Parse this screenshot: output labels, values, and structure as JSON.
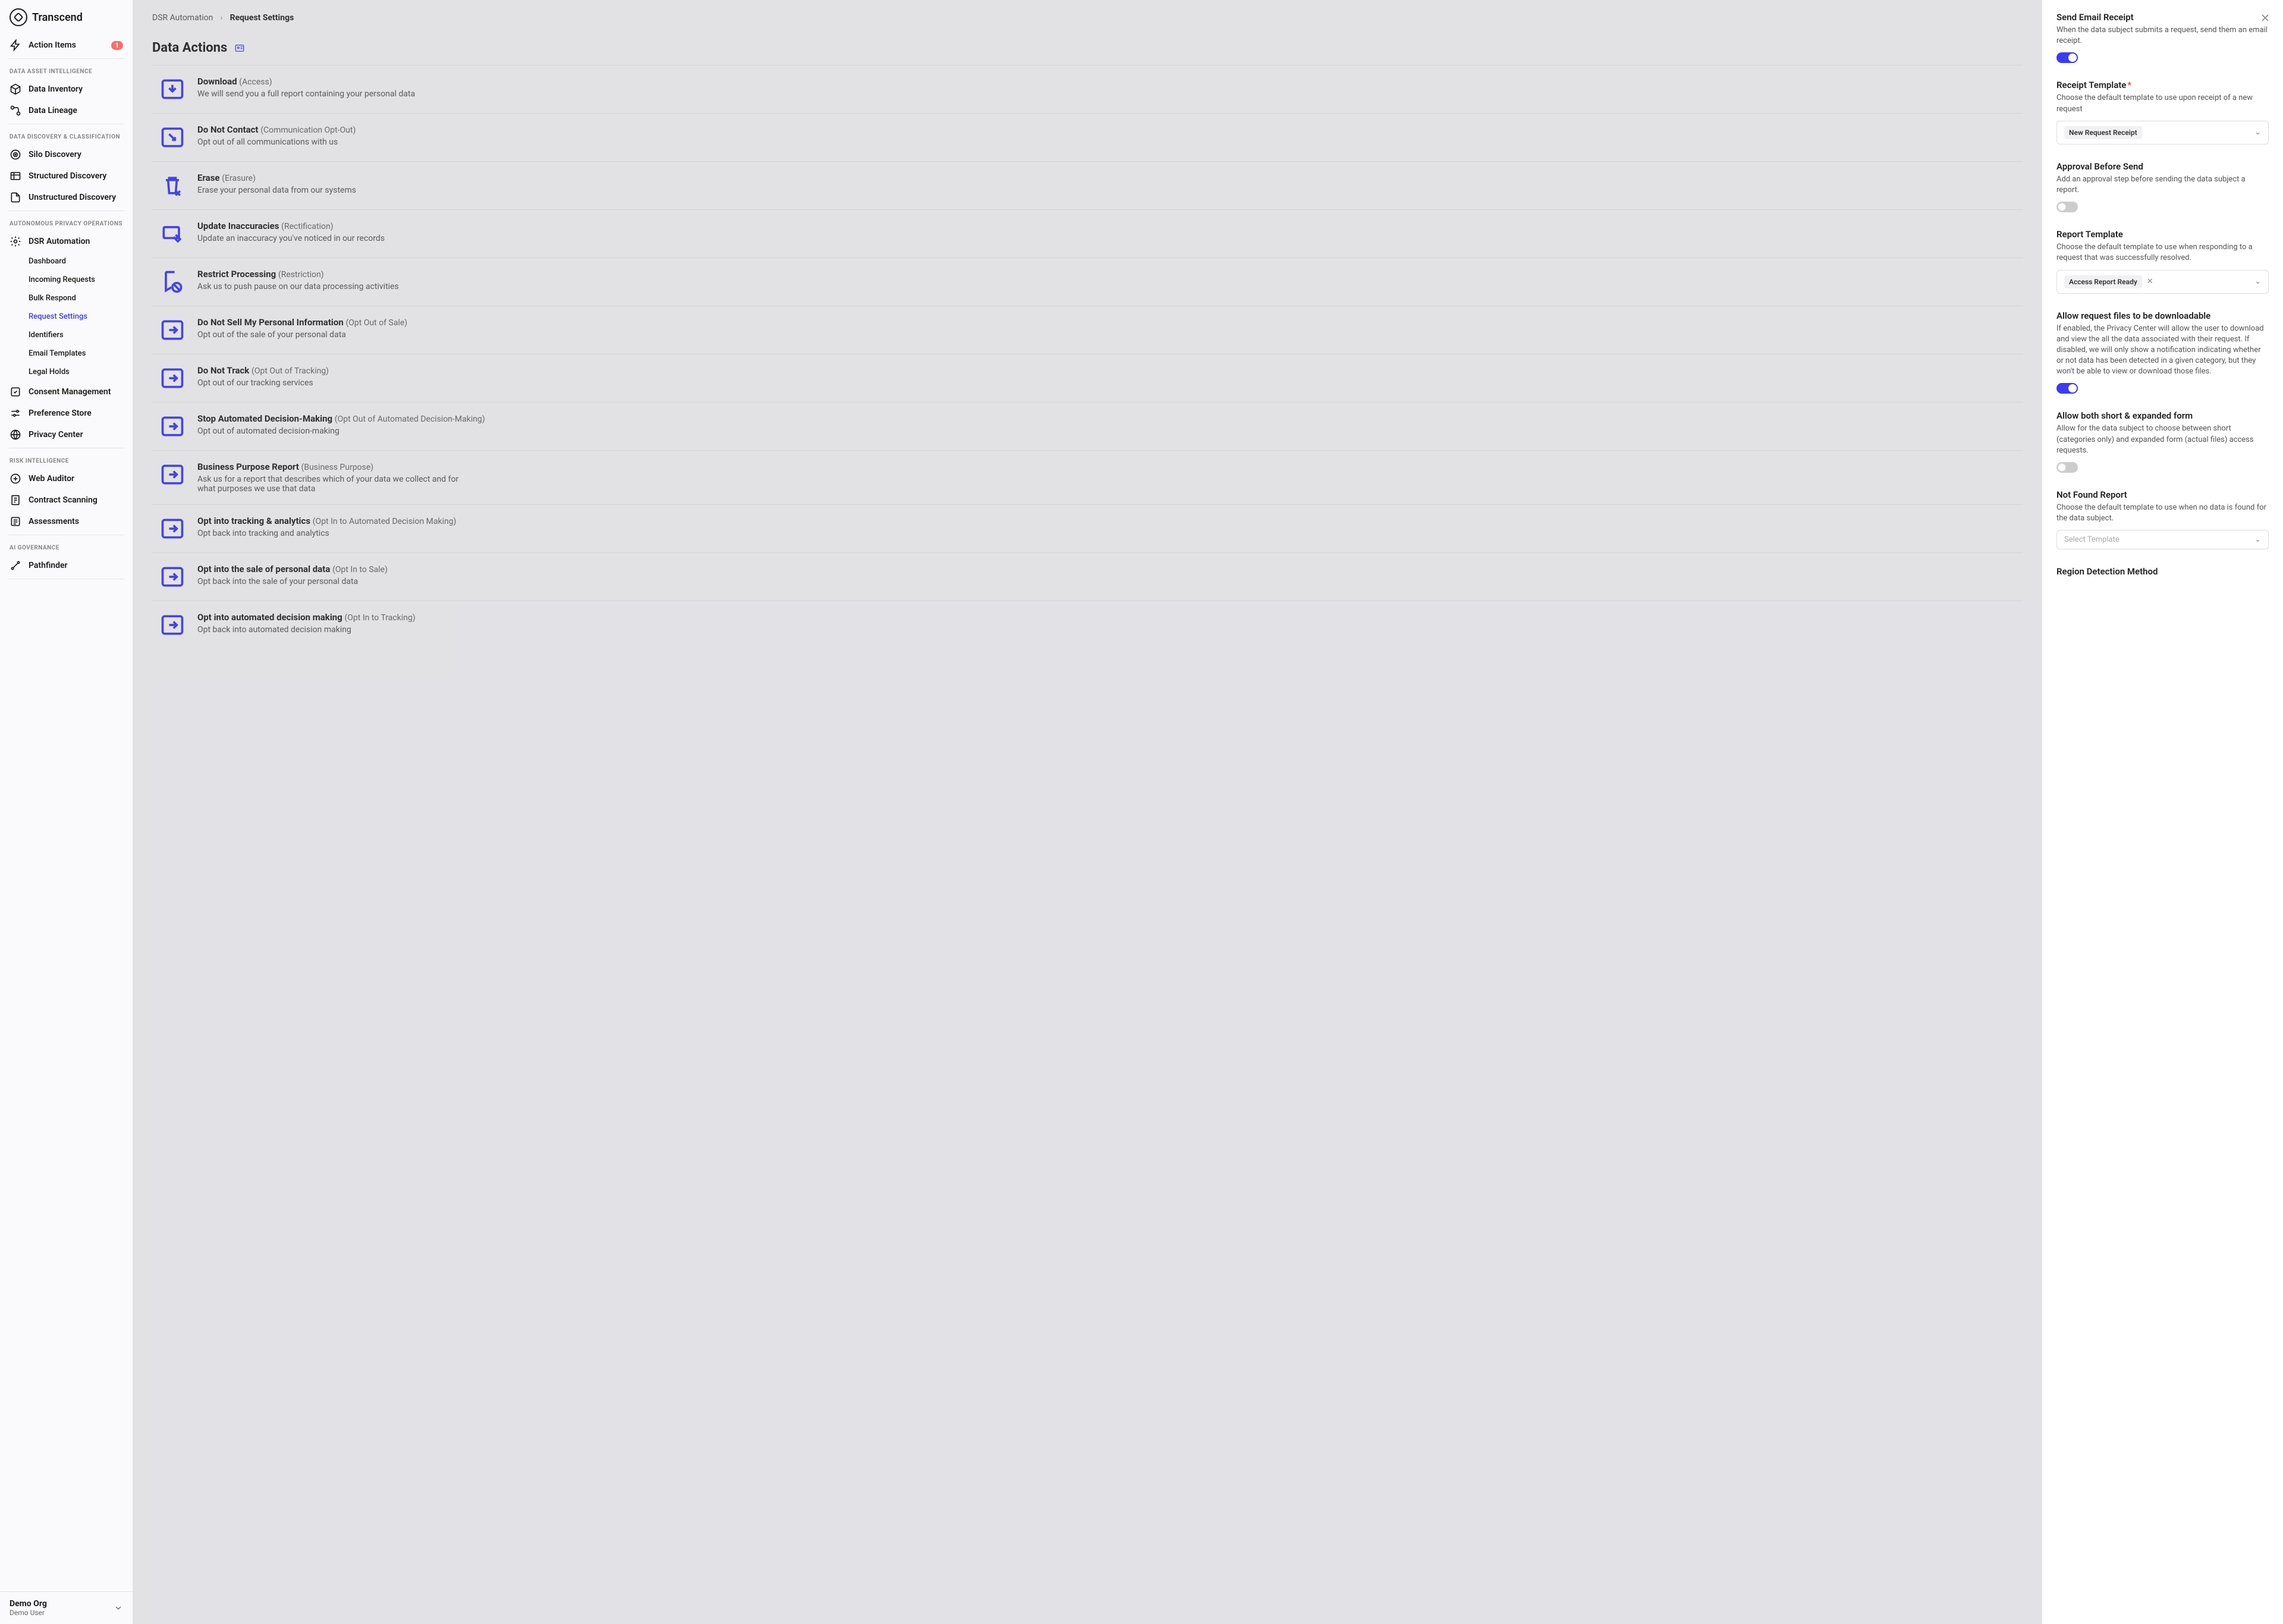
{
  "brand": "Transcend",
  "sidebar": {
    "action_items": {
      "label": "Action Items",
      "badge": "1"
    },
    "sections": [
      {
        "heading": "DATA ASSET INTELLIGENCE",
        "items": [
          {
            "label": "Data Inventory",
            "icon": "cube"
          },
          {
            "label": "Data Lineage",
            "icon": "flow"
          }
        ]
      },
      {
        "heading": "DATA DISCOVERY & CLASSIFICATION",
        "items": [
          {
            "label": "Silo Discovery",
            "icon": "radar"
          },
          {
            "label": "Structured Discovery",
            "icon": "table"
          },
          {
            "label": "Unstructured Discovery",
            "icon": "doc"
          }
        ]
      },
      {
        "heading": "AUTONOMOUS PRIVACY OPERATIONS",
        "items": [
          {
            "label": "DSR Automation",
            "icon": "automation",
            "expanded": true,
            "children": [
              {
                "label": "Dashboard"
              },
              {
                "label": "Incoming Requests"
              },
              {
                "label": "Bulk Respond"
              },
              {
                "label": "Request Settings",
                "active": true
              },
              {
                "label": "Identifiers"
              },
              {
                "label": "Email Templates"
              },
              {
                "label": "Legal Holds"
              }
            ]
          },
          {
            "label": "Consent Management",
            "icon": "consent"
          },
          {
            "label": "Preference Store",
            "icon": "sliders"
          },
          {
            "label": "Privacy Center",
            "icon": "globe"
          }
        ]
      },
      {
        "heading": "RISK INTELLIGENCE",
        "items": [
          {
            "label": "Web Auditor",
            "icon": "web"
          },
          {
            "label": "Contract Scanning",
            "icon": "contract"
          },
          {
            "label": "Assessments",
            "icon": "list"
          }
        ]
      },
      {
        "heading": "AI GOVERNANCE",
        "items": [
          {
            "label": "Pathfinder",
            "icon": "path"
          }
        ]
      }
    ]
  },
  "org": {
    "name": "Demo Org",
    "user": "Demo User"
  },
  "breadcrumb": {
    "parent": "DSR Automation",
    "current": "Request Settings"
  },
  "page_title": "Data Actions",
  "actions": [
    {
      "title": "Download",
      "alt": "(Access)",
      "desc": "We will send you a full report containing your personal data",
      "icon": "download"
    },
    {
      "title": "Do Not Contact",
      "alt": "(Communication Opt-Out)",
      "desc": "Opt out of all communications with us",
      "icon": "optout"
    },
    {
      "title": "Erase",
      "alt": "(Erasure)",
      "desc": "Erase your personal data from our systems",
      "icon": "erase"
    },
    {
      "title": "Update Inaccuracies",
      "alt": "(Rectification)",
      "desc": "Update an inaccuracy you've noticed in our records",
      "icon": "update"
    },
    {
      "title": "Restrict Processing",
      "alt": "(Restriction)",
      "desc": "Ask us to push pause on our data processing activities",
      "icon": "restrict"
    },
    {
      "title": "Do Not Sell My Personal Information",
      "alt": "(Opt Out of Sale)",
      "desc": "Opt out of the sale of your personal data",
      "icon": "arrow"
    },
    {
      "title": "Do Not Track",
      "alt": "(Opt Out of Tracking)",
      "desc": "Opt out of our tracking services",
      "icon": "arrow"
    },
    {
      "title": "Stop Automated Decision-Making",
      "alt": "(Opt Out of Automated Decision-Making)",
      "desc": "Opt out of automated decision-making",
      "icon": "arrow"
    },
    {
      "title": "Business Purpose Report",
      "alt": "(Business Purpose)",
      "desc": "Ask us for a report that describes which of your data we collect and for what purposes we use that data",
      "icon": "arrow"
    },
    {
      "title": "Opt into tracking & analytics",
      "alt": "(Opt In to Automated Decision Making)",
      "desc": "Opt back into tracking and analytics",
      "icon": "arrow"
    },
    {
      "title": "Opt into the sale of personal data",
      "alt": "(Opt In to Sale)",
      "desc": "Opt back into the sale of your personal data",
      "icon": "arrow"
    },
    {
      "title": "Opt into automated decision making",
      "alt": "(Opt In to Tracking)",
      "desc": "Opt back into automated decision making",
      "icon": "arrow"
    }
  ],
  "drawer": {
    "sections": [
      {
        "title": "Send Email Receipt",
        "desc": "When the data subject submits a request, send them an email receipt.",
        "toggle": true
      },
      {
        "title": "Receipt Template",
        "required": true,
        "desc": "Choose the default template to use upon receipt of a new request",
        "select_chip": "New Request Receipt"
      },
      {
        "title": "Approval Before Send",
        "desc": "Add an approval step before sending the data subject a report.",
        "toggle": false
      },
      {
        "title": "Report Template",
        "desc": "Choose the default template to use when responding to a request that was successfully resolved.",
        "select_chip": "Access Report Ready",
        "clearable": true
      },
      {
        "title": "Allow request files to be downloadable",
        "desc": "If enabled, the Privacy Center will allow the user to download and view the all the data associated with their request. If disabled, we will only show a notification indicating whether or not data has been detected in a given category, but they won't be able to view or download those files.",
        "toggle": true
      },
      {
        "title": "Allow both short & expanded form",
        "desc": "Allow for the data subject to choose between short (categories only) and expanded form (actual files) access requests.",
        "toggle": false
      },
      {
        "title": "Not Found Report",
        "desc": "Choose the default template to use when no data is found for the data subject.",
        "select_placeholder": "Select Template"
      },
      {
        "title": "Region Detection Method",
        "desc": ""
      }
    ]
  }
}
